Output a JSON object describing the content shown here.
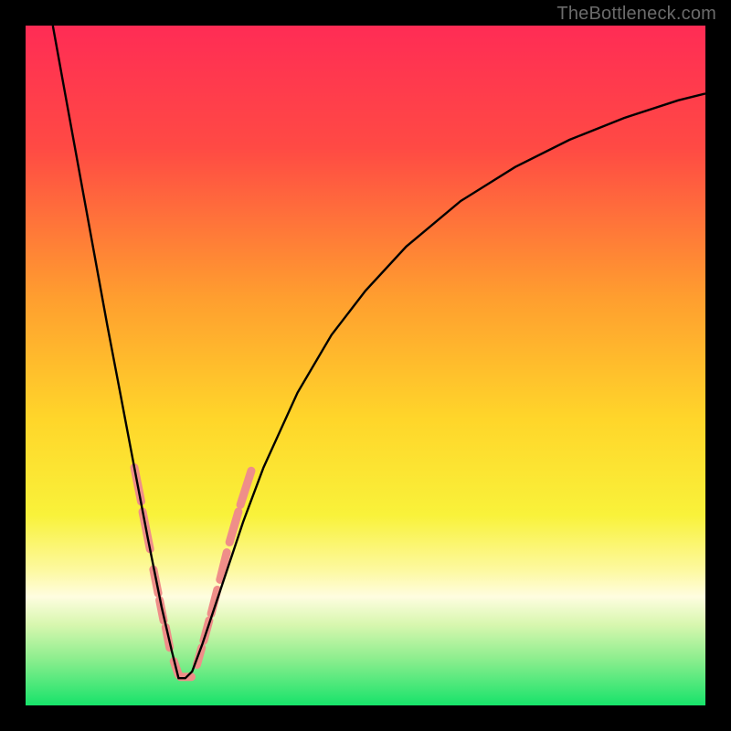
{
  "watermark": "TheBottleneck.com",
  "chart_data": {
    "type": "line",
    "title": "",
    "xlabel": "",
    "ylabel": "",
    "xlim": [
      0,
      1
    ],
    "ylim": [
      0,
      1
    ],
    "note": "Axes are unlabeled; x and y are normalized fractions of the plot area (origin at top-left for y). The curve depicts a bottleneck-style V shape reaching a minimum near x≈0.23.",
    "background_gradient_stops": [
      {
        "pos": 0.0,
        "color": "#ff2c55"
      },
      {
        "pos": 0.18,
        "color": "#ff4a44"
      },
      {
        "pos": 0.4,
        "color": "#ff9e2f"
      },
      {
        "pos": 0.58,
        "color": "#ffd62a"
      },
      {
        "pos": 0.72,
        "color": "#f9f23a"
      },
      {
        "pos": 0.8,
        "color": "#fdf99e"
      },
      {
        "pos": 0.84,
        "color": "#fefde0"
      },
      {
        "pos": 0.88,
        "color": "#d9f7b0"
      },
      {
        "pos": 0.93,
        "color": "#8fee8f"
      },
      {
        "pos": 1.0,
        "color": "#17e36a"
      }
    ],
    "series": [
      {
        "name": "bottleneck-curve",
        "stroke": "#000000",
        "x": [
          0.04,
          0.06,
          0.08,
          0.1,
          0.12,
          0.14,
          0.16,
          0.18,
          0.2,
          0.215,
          0.225,
          0.235,
          0.245,
          0.26,
          0.28,
          0.3,
          0.32,
          0.35,
          0.4,
          0.45,
          0.5,
          0.56,
          0.64,
          0.72,
          0.8,
          0.88,
          0.96,
          1.0
        ],
        "y": [
          0.0,
          0.11,
          0.22,
          0.33,
          0.44,
          0.545,
          0.65,
          0.755,
          0.855,
          0.92,
          0.96,
          0.96,
          0.95,
          0.91,
          0.85,
          0.79,
          0.73,
          0.65,
          0.54,
          0.455,
          0.39,
          0.325,
          0.258,
          0.208,
          0.168,
          0.136,
          0.11,
          0.1
        ]
      }
    ],
    "markers": {
      "name": "salmon-dashes",
      "color": "#ef8e89",
      "stroke_width": 9,
      "segments": [
        {
          "x1": 0.16,
          "y1": 0.65,
          "x2": 0.17,
          "y2": 0.7
        },
        {
          "x1": 0.172,
          "y1": 0.715,
          "x2": 0.183,
          "y2": 0.77
        },
        {
          "x1": 0.188,
          "y1": 0.8,
          "x2": 0.195,
          "y2": 0.835
        },
        {
          "x1": 0.197,
          "y1": 0.845,
          "x2": 0.203,
          "y2": 0.875
        },
        {
          "x1": 0.206,
          "y1": 0.885,
          "x2": 0.212,
          "y2": 0.915
        },
        {
          "x1": 0.218,
          "y1": 0.935,
          "x2": 0.225,
          "y2": 0.955
        },
        {
          "x1": 0.228,
          "y1": 0.958,
          "x2": 0.244,
          "y2": 0.958
        },
        {
          "x1": 0.252,
          "y1": 0.94,
          "x2": 0.259,
          "y2": 0.915
        },
        {
          "x1": 0.262,
          "y1": 0.905,
          "x2": 0.27,
          "y2": 0.875
        },
        {
          "x1": 0.273,
          "y1": 0.865,
          "x2": 0.282,
          "y2": 0.83
        },
        {
          "x1": 0.286,
          "y1": 0.815,
          "x2": 0.296,
          "y2": 0.775
        },
        {
          "x1": 0.3,
          "y1": 0.76,
          "x2": 0.313,
          "y2": 0.715
        },
        {
          "x1": 0.316,
          "y1": 0.705,
          "x2": 0.332,
          "y2": 0.655
        }
      ]
    }
  }
}
